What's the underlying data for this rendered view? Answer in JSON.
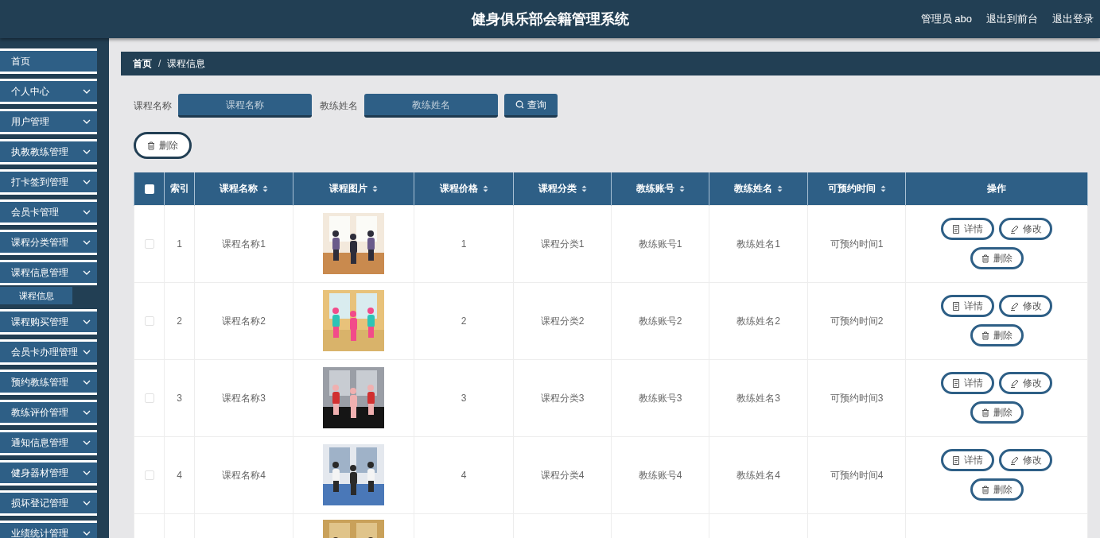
{
  "header": {
    "title": "健身俱乐部会籍管理系统",
    "links": [
      "管理员 abo",
      "退出到前台",
      "退出登录"
    ]
  },
  "sidebar": {
    "items": [
      {
        "label": "首页",
        "kind": "link"
      },
      {
        "label": "个人中心",
        "kind": "menu"
      },
      {
        "label": "用户管理",
        "kind": "menu"
      },
      {
        "label": "执教教练管理",
        "kind": "menu"
      },
      {
        "label": "打卡签到管理",
        "kind": "menu"
      },
      {
        "label": "会员卡管理",
        "kind": "menu"
      },
      {
        "label": "课程分类管理",
        "kind": "menu"
      },
      {
        "label": "课程信息管理",
        "kind": "menu",
        "children": [
          {
            "label": "课程信息",
            "selected": true
          }
        ]
      },
      {
        "label": "课程购买管理",
        "kind": "menu"
      },
      {
        "label": "会员卡办理管理",
        "kind": "menu"
      },
      {
        "label": "预约教练管理",
        "kind": "menu"
      },
      {
        "label": "教练评价管理",
        "kind": "menu"
      },
      {
        "label": "通知信息管理",
        "kind": "menu"
      },
      {
        "label": "健身器材管理",
        "kind": "menu"
      },
      {
        "label": "损坏登记管理",
        "kind": "menu"
      },
      {
        "label": "业绩统计管理",
        "kind": "menu"
      }
    ]
  },
  "breadcrumb": {
    "home": "首页",
    "separator": "/",
    "current": "课程信息"
  },
  "search": {
    "fields": [
      {
        "label": "课程名称",
        "placeholder": "课程名称"
      },
      {
        "label": "教练姓名",
        "placeholder": "教练姓名"
      }
    ],
    "button": "查询"
  },
  "toolbar": {
    "delete_button": "删除"
  },
  "table": {
    "select_all_checked": false,
    "columns": [
      {
        "kind": "checkbox"
      },
      {
        "kind": "text",
        "label": "索引",
        "sortable": false
      },
      {
        "kind": "text",
        "label": "课程名称",
        "sortable": true
      },
      {
        "kind": "picture",
        "label": "课程图片",
        "sortable": true
      },
      {
        "kind": "text",
        "label": "课程价格",
        "sortable": true
      },
      {
        "kind": "text",
        "label": "课程分类",
        "sortable": true
      },
      {
        "kind": "text",
        "label": "教练账号",
        "sortable": true
      },
      {
        "kind": "text",
        "label": "教练姓名",
        "sortable": true
      },
      {
        "kind": "text",
        "label": "可预约时间",
        "sortable": true
      },
      {
        "kind": "actions",
        "label": "操作",
        "sortable": false
      }
    ],
    "rows": [
      {
        "checked": false,
        "values": [
          "1",
          "课程名称1",
          "1",
          "课程分类1",
          "教练账号1",
          "教练姓名1",
          "可预约时间1"
        ],
        "actions": [
          "详情",
          "修改",
          "删除"
        ]
      },
      {
        "checked": false,
        "values": [
          "2",
          "课程名称2",
          "2",
          "课程分类2",
          "教练账号2",
          "教练姓名2",
          "可预约时间2"
        ],
        "actions": [
          "详情",
          "修改",
          "删除"
        ]
      },
      {
        "checked": false,
        "values": [
          "3",
          "课程名称3",
          "3",
          "课程分类3",
          "教练账号3",
          "教练姓名3",
          "可预约时间3"
        ],
        "actions": [
          "详情",
          "修改",
          "删除"
        ]
      },
      {
        "checked": false,
        "values": [
          "4",
          "课程名称4",
          "4",
          "课程分类4",
          "教练账号4",
          "教练姓名4",
          "可预约时间4"
        ],
        "actions": [
          "详情",
          "修改",
          "删除"
        ]
      }
    ]
  }
}
